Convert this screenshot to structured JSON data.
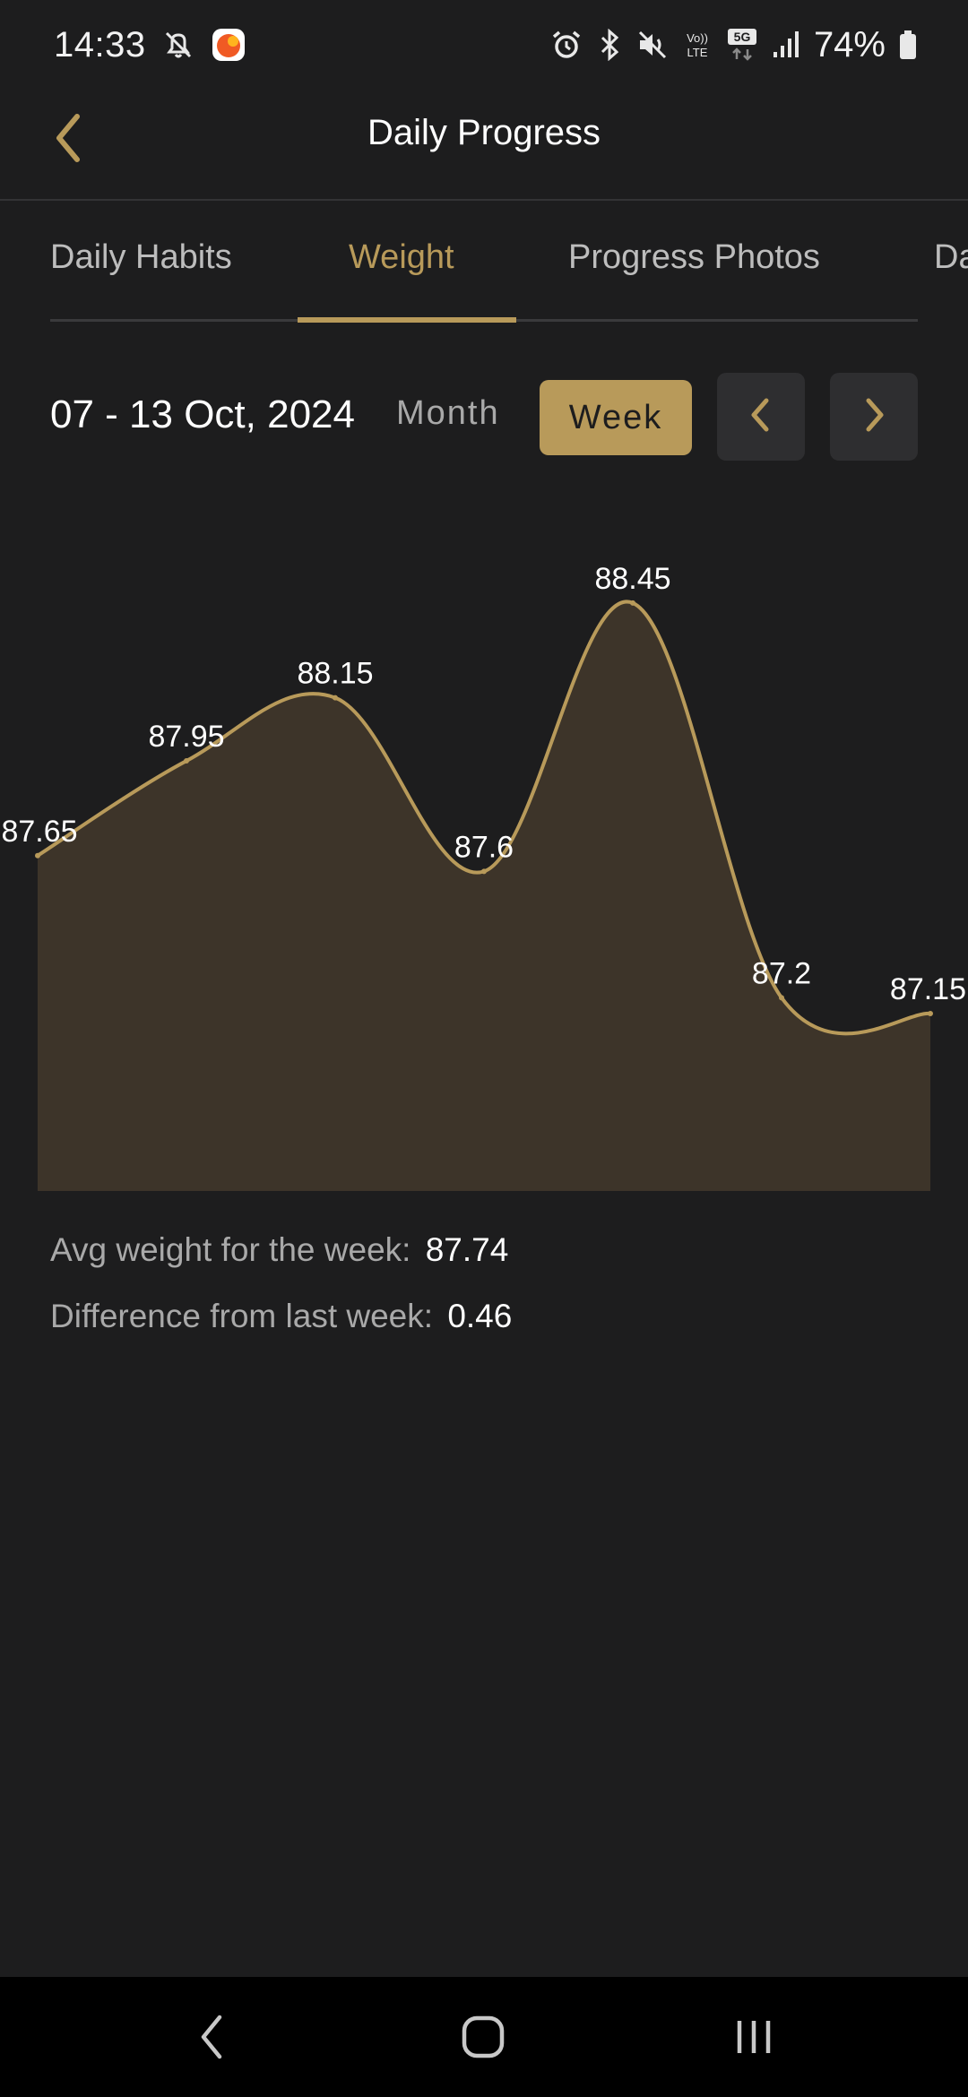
{
  "status_bar": {
    "time": "14:33",
    "battery": "74%",
    "icons": [
      "notifications-off-icon",
      "app-notification-icon",
      "alarm-icon",
      "bluetooth-icon",
      "mute-icon",
      "volte-icon",
      "5g-icon",
      "signal-icon",
      "battery-icon"
    ]
  },
  "header": {
    "title": "Daily Progress",
    "back_icon": "chevron-left-icon"
  },
  "tabs": [
    {
      "label": "Daily Habits",
      "active": false
    },
    {
      "label": "Weight",
      "active": true
    },
    {
      "label": "Progress Photos",
      "active": false
    },
    {
      "label": "Da",
      "active": false
    }
  ],
  "range": {
    "date_range": "07 - 13 Oct, 2024",
    "month_label": "Month",
    "week_label": "Week",
    "selected": "Week"
  },
  "chart_data": {
    "type": "area",
    "x": [
      1,
      2,
      3,
      4,
      5,
      6,
      7
    ],
    "series": [
      {
        "values": [
          87.65,
          87.95,
          88.15,
          87.6,
          88.45,
          87.2,
          87.15
        ]
      }
    ],
    "data_labels": [
      "87.65",
      "87.95",
      "88.15",
      "87.6",
      "88.45",
      "87.2",
      "87.15"
    ],
    "ylim": [
      86.5,
      88.6
    ],
    "grid": false,
    "line_color": "#b89a5a",
    "fill_color": "#3d3429"
  },
  "stats": {
    "avg_label": "Avg weight for the week:",
    "avg_value": "87.74",
    "diff_label": "Difference from last week:",
    "diff_value": "0.46"
  },
  "colors": {
    "accent": "#b89a5a",
    "background": "#1d1d1e",
    "button_dark": "#2e2e30"
  }
}
